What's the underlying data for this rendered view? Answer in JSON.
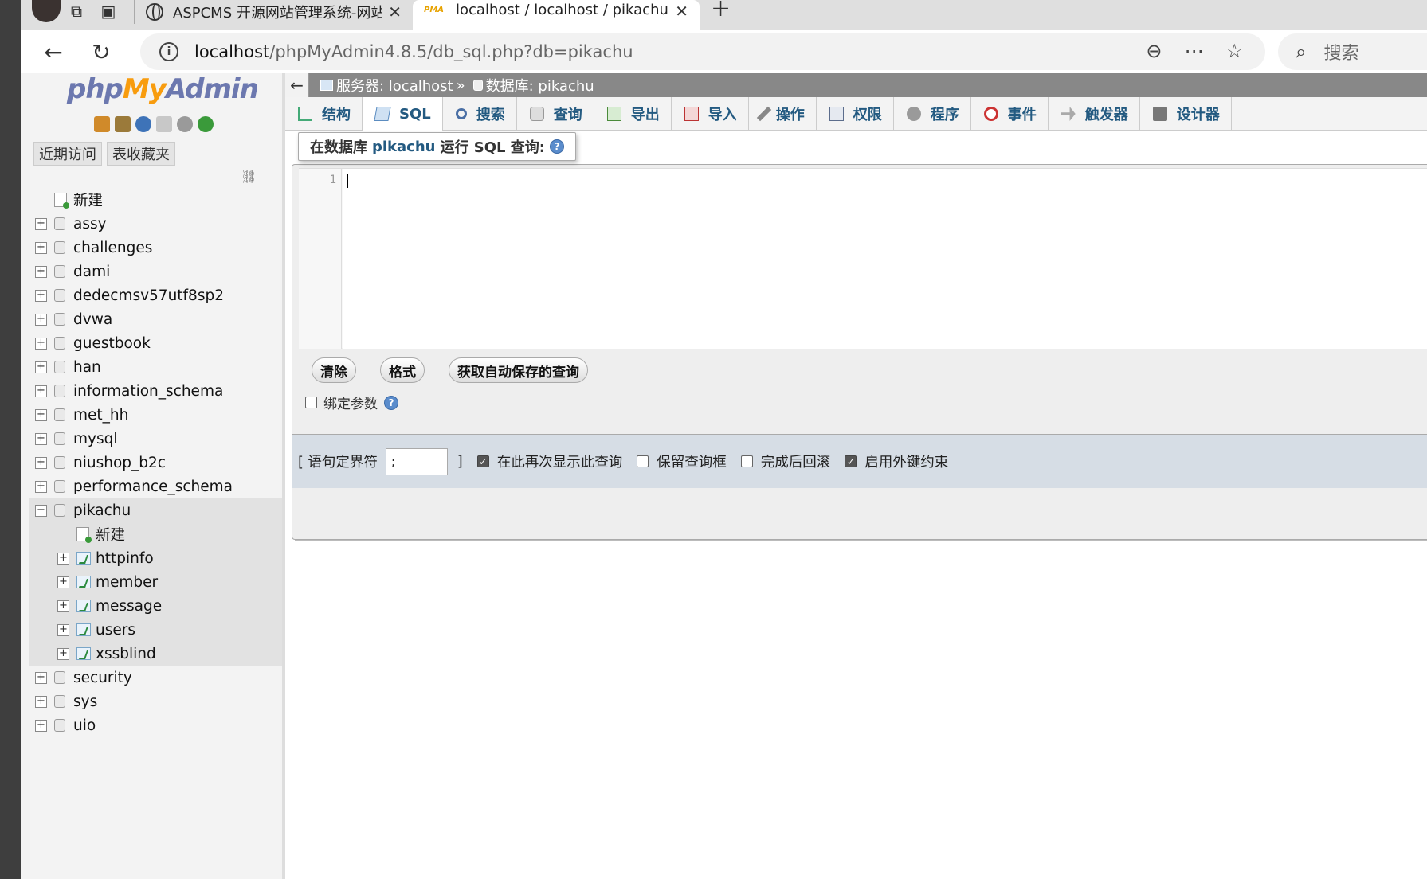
{
  "browser": {
    "tabs": [
      {
        "title": "ASPCMS 开源网站管理系统-网站",
        "close": "✕"
      },
      {
        "title": "localhost / localhost / pikachu | p",
        "close": "✕",
        "logo": "PMA"
      }
    ],
    "newtab": "+",
    "url_host": "localhost",
    "url_path": "/phpMyAdmin4.8.5/db_sql.php?db=pikachu",
    "search_placeholder": "搜索"
  },
  "sidebar": {
    "brand_php": "php",
    "brand_my": "My",
    "brand_admin": "Admin",
    "recent": "近期访问",
    "favorites": "表收藏夹",
    "tree": [
      {
        "label": "新建",
        "type": "new"
      },
      {
        "label": "assy"
      },
      {
        "label": "challenges"
      },
      {
        "label": "dami"
      },
      {
        "label": "dedecmsv57utf8sp2"
      },
      {
        "label": "dvwa"
      },
      {
        "label": "guestbook"
      },
      {
        "label": "han"
      },
      {
        "label": "information_schema"
      },
      {
        "label": "met_hh"
      },
      {
        "label": "mysql"
      },
      {
        "label": "niushop_b2c"
      },
      {
        "label": "performance_schema"
      }
    ],
    "pikachu": {
      "label": "pikachu",
      "children": [
        "新建",
        "httpinfo",
        "member",
        "message",
        "users",
        "xssblind"
      ]
    },
    "tree_after": [
      {
        "label": "security"
      },
      {
        "label": "sys"
      },
      {
        "label": "uio"
      }
    ]
  },
  "main": {
    "breadcrumb_server": "服务器: localhost",
    "breadcrumb_sep": "»",
    "breadcrumb_db": "数据库: pikachu",
    "tabs": [
      "结构",
      "SQL",
      "搜索",
      "查询",
      "导出",
      "导入",
      "操作",
      "权限",
      "程序",
      "事件",
      "触发器",
      "设计器"
    ],
    "active_tab": "SQL",
    "legend_prefix": "在数据库",
    "legend_db": "pikachu",
    "legend_suffix": "运行 SQL 查询:",
    "line_number": "1",
    "buttons": {
      "clear": "清除",
      "format": "格式",
      "autosave": "获取自动保存的查询"
    },
    "bind_params": "绑定参数",
    "delimiter_label": "[ 语句定界符",
    "delimiter_value": ";",
    "delimiter_close": "]",
    "options": [
      {
        "label": "在此再次显示此查询",
        "checked": true
      },
      {
        "label": "保留查询框",
        "checked": false
      },
      {
        "label": "完成后回滚",
        "checked": false
      },
      {
        "label": "启用外键约束",
        "checked": true
      }
    ]
  }
}
